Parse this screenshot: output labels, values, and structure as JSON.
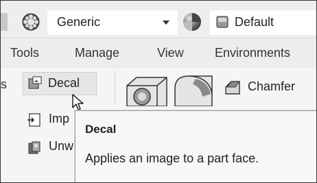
{
  "toolbar": {
    "material_icon": "material-ball-icon",
    "material_value": "Generic",
    "appearance_icon": "appearance-ball-icon",
    "appearance_value": "Default"
  },
  "tabs": [
    {
      "label": "Tools"
    },
    {
      "label": "Manage"
    },
    {
      "label": "View"
    },
    {
      "label": "Environments"
    }
  ],
  "ribbon": {
    "truncated_left": "s",
    "decal": {
      "label": "Decal",
      "icon": "decal-icon"
    },
    "import": {
      "label": "Imp",
      "icon": "import-icon"
    },
    "unwrap": {
      "label": "Unw",
      "icon": "unwrap-icon"
    },
    "chamfer": {
      "label": "Chamfer",
      "icon": "chamfer-icon"
    },
    "fillet_icon": "fillet-icon",
    "shell_icon": "shell-icon"
  },
  "tooltip": {
    "title": "Decal",
    "description": "Applies an image to a part face."
  },
  "colors": {
    "ribbon_bg": "#f5f5f5",
    "tooltip_bg": "#f7f7f7",
    "hover_bg": "#e6e6e6"
  }
}
